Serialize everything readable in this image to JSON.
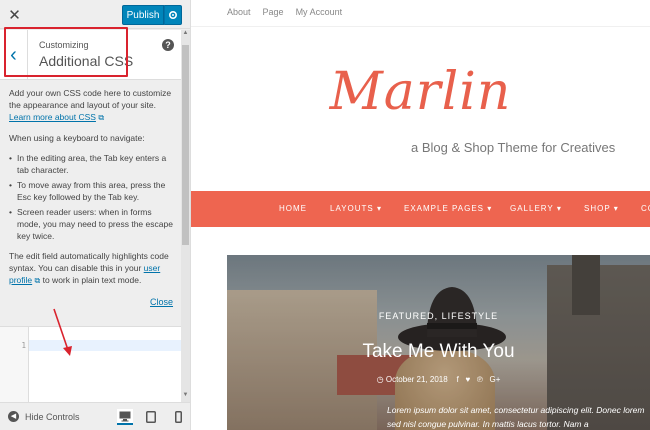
{
  "sidebar": {
    "close_label": "✕",
    "publish_label": "Publish",
    "section_small": "Customizing",
    "section_title": "Additional CSS",
    "help_label": "?",
    "back_label": "‹",
    "desc1": "Add your own CSS code here to customize the appearance and layout of your site.",
    "learn_more": "Learn more about CSS",
    "keyboard_intro": "When using a keyboard to navigate:",
    "bullets": [
      "In the editing area, the Tab key enters a tab character.",
      "To move away from this area, press the Esc key followed by the Tab key.",
      "Screen reader users: when in forms mode, you may need to press the escape key twice."
    ],
    "highlight_pre": "The edit field automatically highlights code syntax. You can disable this in your ",
    "user_profile": "user profile",
    "highlight_post": " to work in plain text mode.",
    "close_link": "Close",
    "line_number": "1",
    "hide_controls": "Hide Controls"
  },
  "preview": {
    "topnav": [
      "About",
      "Page",
      "My Account"
    ],
    "logo": "Marlin",
    "tagline": "a Blog & Shop Theme for Creatives",
    "mainnav": [
      {
        "label": "HOME"
      },
      {
        "label": "LAYOUTS ▾"
      },
      {
        "label": "EXAMPLE PAGES ▾"
      },
      {
        "label": "GALLERY ▾"
      },
      {
        "label": "SHOP ▾"
      },
      {
        "label": "CO"
      }
    ],
    "hero": {
      "categories": "FEATURED, LIFESTYLE",
      "title": "Take Me With You",
      "date": "October 21, 2018",
      "excerpt": "Lorem ipsum dolor sit amet, consectetur adipiscing elit. Donec lorem sed nisl congue pulvinar. In mattis lacus tortor. Nam a"
    }
  },
  "colors": {
    "accent": "#e8604c",
    "nav_bg": "#ee6550",
    "publish_bg": "#0085ba",
    "highlight": "#d9232e"
  },
  "icons": [
    "close-icon",
    "gear-icon",
    "chevron-left-icon",
    "help-icon",
    "external-link-icon",
    "arrow-annotation",
    "hide-controls-icon",
    "desktop-icon",
    "tablet-icon",
    "mobile-icon",
    "clock-icon",
    "facebook-icon",
    "twitter-icon",
    "pinterest-icon",
    "googleplus-icon"
  ]
}
